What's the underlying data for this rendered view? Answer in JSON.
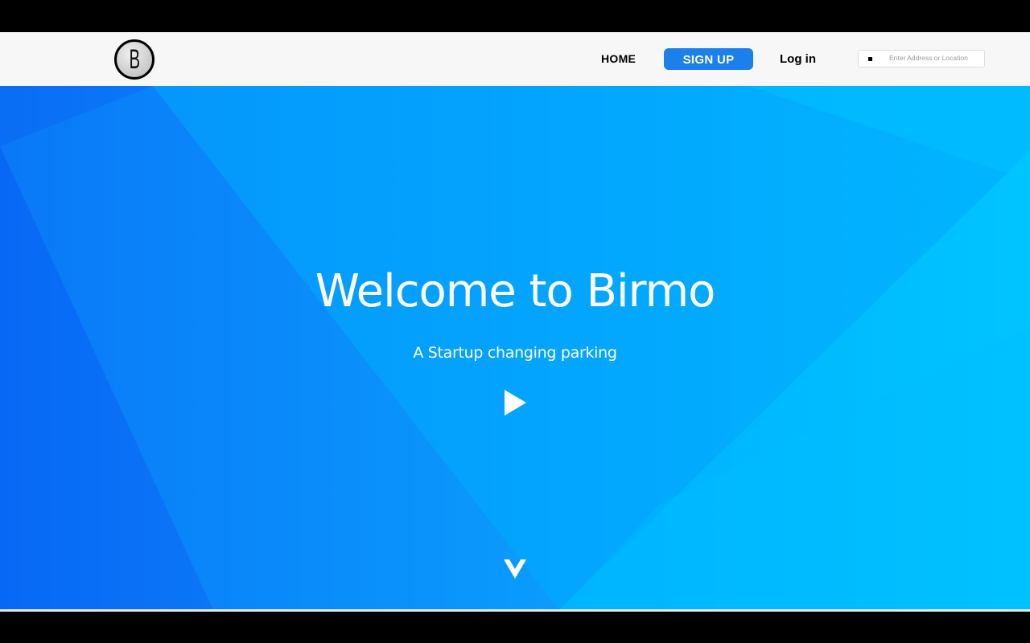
{
  "logo": {
    "letter": "B",
    "icon": "birmo-logo"
  },
  "nav": {
    "home_label": "HOME",
    "signup_label": "SIGN UP",
    "login_label": "Log in",
    "signup_color": "#1b7fec"
  },
  "search": {
    "placeholder": "Enter Address or Location",
    "icon": "search-icon"
  },
  "hero": {
    "title": "Welcome to Birmo",
    "subtitle": "A Startup changing parking",
    "play_icon": "play-icon",
    "scroll_icon": "chevron-down-icon",
    "gradient_colors": [
      "#0a6df5",
      "#0a8cfb",
      "#05a8fe",
      "#00bcff"
    ]
  }
}
